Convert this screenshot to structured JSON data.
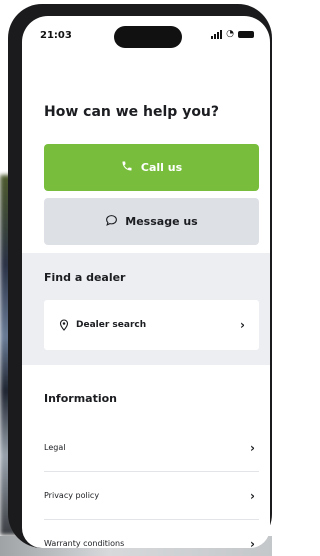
{
  "status_bar": {
    "time": "21:03"
  },
  "help": {
    "heading": "How can we help you?",
    "call_label": "Call us",
    "message_label": "Message us"
  },
  "dealer": {
    "title": "Find a dealer",
    "search_label": "Dealer search"
  },
  "information": {
    "title": "Information",
    "items": [
      {
        "label": "Legal"
      },
      {
        "label": "Privacy policy"
      },
      {
        "label": "Warranty conditions"
      }
    ]
  },
  "colors": {
    "accent_green": "#78be3c",
    "secondary_button": "#dde0e5",
    "section_background": "#eceef1",
    "text": "#1b1d21"
  },
  "icons": {
    "call": "phone-icon",
    "message": "chat-bubble-icon",
    "dealer": "dealer-pin-icon",
    "chevron": "chevron-right-icon"
  }
}
